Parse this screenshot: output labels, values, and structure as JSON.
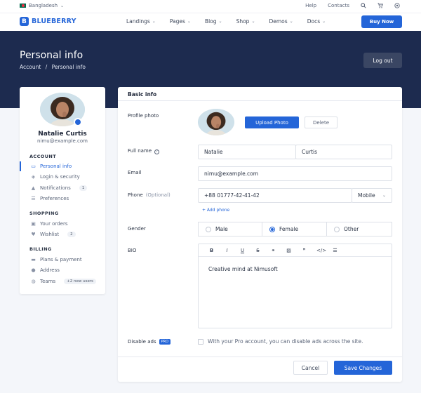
{
  "topbar": {
    "region": "Bangladesh",
    "help": "Help",
    "contacts": "Contacts"
  },
  "navbar": {
    "logo": "BLUEBERRY",
    "logo_mark": "B",
    "menu": [
      "Landings",
      "Pages",
      "Blog",
      "Shop",
      "Demos",
      "Docs"
    ],
    "buy": "Buy Now"
  },
  "hero": {
    "title": "Personal info",
    "crumb_home": "Account",
    "crumb_sep": "/",
    "crumb_current": "Personal info",
    "logout": "Log out"
  },
  "sidebar": {
    "name": "Natalie Curtis",
    "email": "nimu@example.com",
    "sections": {
      "account": "ACCOUNT",
      "shopping": "SHOPPING",
      "billing": "BILLING"
    },
    "items": [
      {
        "label": "Personal info",
        "icon": "id-card-icon"
      },
      {
        "label": "Login & security",
        "icon": "shield-icon"
      },
      {
        "label": "Notifications",
        "icon": "bell-icon",
        "badge": "1"
      },
      {
        "label": "Preferences",
        "icon": "sliders-icon"
      },
      {
        "label": "Your orders",
        "icon": "cart-icon"
      },
      {
        "label": "Wishlist",
        "icon": "heart-icon",
        "badge": "2"
      },
      {
        "label": "Plans & payment",
        "icon": "card-icon"
      },
      {
        "label": "Address",
        "icon": "map-pin-icon"
      },
      {
        "label": "Teams",
        "icon": "users-icon",
        "badge": "+2 new users"
      }
    ]
  },
  "form": {
    "header": "Basic info",
    "profile_photo_label": "Profile photo",
    "upload": "Upload Photo",
    "delete": "Delete",
    "fullname_label": "Full name",
    "first_name": "Natalie",
    "last_name": "Curtis",
    "email_label": "Email",
    "email_value": "nimu@example.com",
    "phone_label": "Phone",
    "phone_optional": "(Optional)",
    "phone_value": "+88 01777-42-41-42",
    "phone_type": "Mobile",
    "add_phone": "+ Add phone",
    "gender_label": "Gender",
    "gender_options": [
      "Male",
      "Female",
      "Other"
    ],
    "gender_selected": "Female",
    "bio_label": "BIO",
    "bio_value": "Creative mind at Nimusoft",
    "toolbar": [
      "B",
      "I",
      "U",
      "S",
      "link",
      "image",
      "quote",
      "code",
      "list"
    ],
    "disable_ads_label": "Disable ads",
    "pro_badge": "PRO",
    "disable_ads_text": "With your Pro account, you can disable ads across the site.",
    "cancel": "Cancel",
    "save": "Save Changes"
  },
  "colors": {
    "primary": "#2465d8",
    "hero": "#1d2b4f",
    "background": "#f4f6fa"
  }
}
